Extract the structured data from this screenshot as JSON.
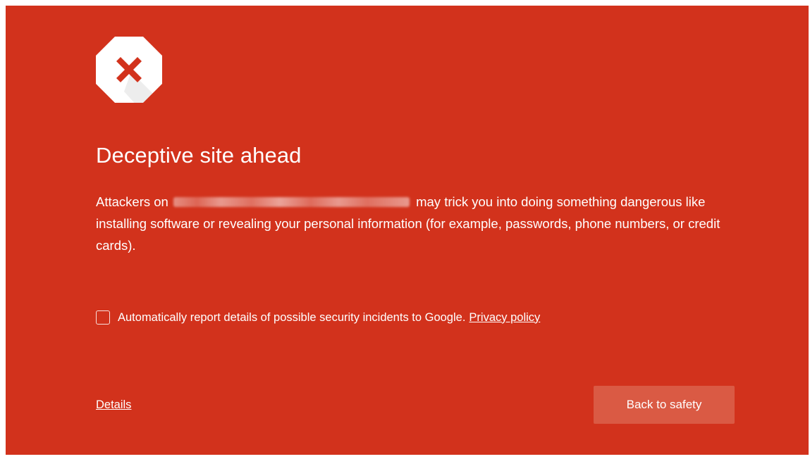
{
  "colors": {
    "background": "#d2321c",
    "text": "#ffffff",
    "icon_fill": "#ffffff",
    "icon_x": "#d2321c",
    "button_bg": "#da5a44"
  },
  "icon": "stop-octagon-x-icon",
  "title": "Deceptive site ahead",
  "message": {
    "prefix": "Attackers on",
    "url_blurred": true,
    "suffix": "may trick you into doing something dangerous like installing software or revealing your personal information (for example, passwords, phone numbers, or credit cards)."
  },
  "report": {
    "checked": false,
    "label": "Automatically report details of possible security incidents to Google.",
    "privacy_link": "Privacy policy"
  },
  "details_link": "Details",
  "back_button": "Back to safety"
}
